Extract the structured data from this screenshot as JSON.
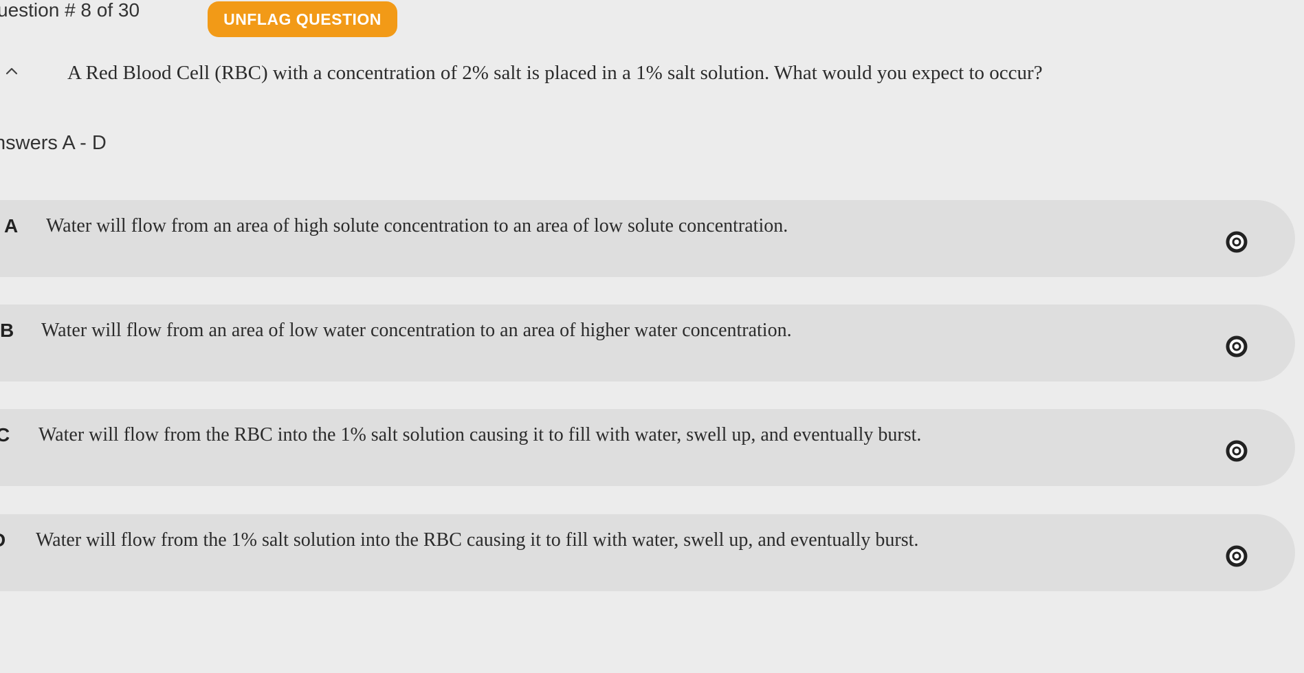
{
  "header": {
    "question_number": "uestion # 8 of 30",
    "unflag_label": "UNFLAG QUESTION",
    "accent_color": "#f29a17"
  },
  "question": {
    "collapse_icon": "chevron-up-icon",
    "text": "A Red Blood Cell (RBC) with a concentration of 2% salt is placed in a 1% salt solution. What would you expect to occur?"
  },
  "answers": {
    "label": "nswers A - D",
    "options": [
      {
        "letter": "A",
        "text": "Water will flow from an area of high solute concentration to an area of low solute concentration.",
        "icon": "radio-unselected-icon"
      },
      {
        "letter": "B",
        "text": "Water will flow from an area of low water concentration to an area of higher water concentration.",
        "icon": "radio-unselected-icon"
      },
      {
        "letter": "C",
        "text": "Water will flow from the RBC into the 1% salt solution causing it to fill with water, swell up, and eventually burst.",
        "icon": "radio-unselected-icon"
      },
      {
        "letter": "D",
        "text": "Water will flow from the 1% salt solution into the RBC causing it to fill with water, swell up, and eventually burst.",
        "icon": "radio-unselected-icon"
      }
    ]
  }
}
